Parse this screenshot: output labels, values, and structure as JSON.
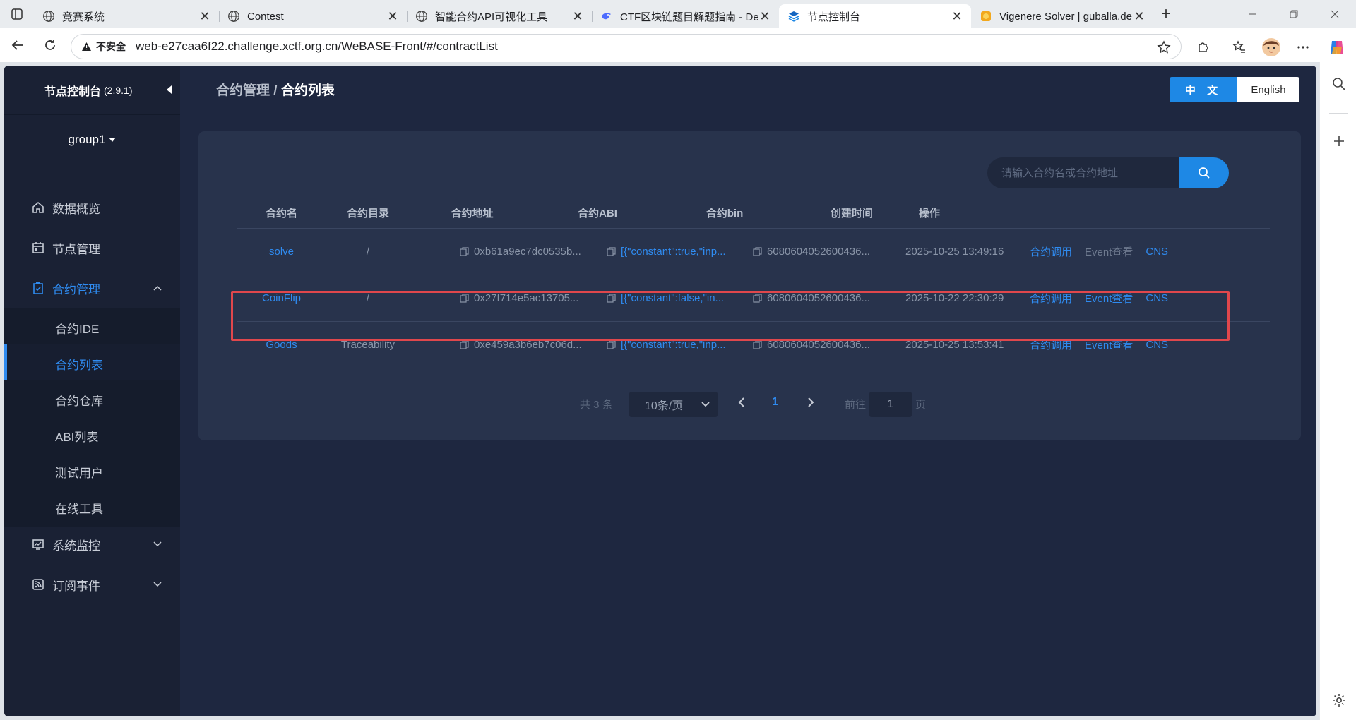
{
  "browser": {
    "tabs": [
      {
        "title": "竞赛系统",
        "icon": "globe-icon"
      },
      {
        "title": "Contest",
        "icon": "globe-icon"
      },
      {
        "title": "智能合约API可视化工具",
        "icon": "globe-icon"
      },
      {
        "title": "CTF区块链题目解题指南 - De",
        "icon": "deepseek-icon"
      },
      {
        "title": "节点控制台",
        "icon": "webase-layers-icon",
        "active": true
      },
      {
        "title": "Vigenere Solver | guballa.de",
        "icon": "guballa-icon"
      }
    ],
    "security_label": "不安全",
    "url": "web-e27caa6f22.challenge.xctf.org.cn/WeBASE-Front/#/contractList"
  },
  "sidebar": {
    "brand": "节点控制台",
    "version": "(2.9.1)",
    "group": "group1",
    "menu": [
      {
        "label": "数据概览",
        "icon": "home-icon"
      },
      {
        "label": "节点管理",
        "icon": "calendar-icon"
      },
      {
        "label": "合约管理",
        "icon": "clipboard-check-icon",
        "open": true
      },
      {
        "label": "系统监控",
        "icon": "chart-monitor-icon"
      },
      {
        "label": "订阅事件",
        "icon": "rss-icon"
      }
    ],
    "submenu": [
      "合约IDE",
      "合约列表",
      "合约仓库",
      "ABI列表",
      "测试用户",
      "在线工具"
    ]
  },
  "header": {
    "breadcrumb_parent": "合约管理",
    "breadcrumb_sep": " / ",
    "breadcrumb_current": "合约列表",
    "lang_zh": "中 文",
    "lang_en": "English"
  },
  "search": {
    "placeholder": "请输入合约名或合约地址"
  },
  "table": {
    "columns": [
      "合约名",
      "合约目录",
      "合约地址",
      "合约ABI",
      "合约bin",
      "创建时间",
      "操作"
    ],
    "rows": [
      {
        "name": "solve",
        "dir": "/",
        "address": "0xb61a9ec7dc0535b...",
        "abi": "[{\"constant\":true,\"inp...",
        "bin": "6080604052600436...",
        "time": "2025-10-25 13:49:16",
        "op_call": "合约调用",
        "op_event": "Event查看",
        "op_cns": "CNS"
      },
      {
        "name": "CoinFlip",
        "dir": "/",
        "address": "0x27f714e5ac13705...",
        "abi": "[{\"constant\":false,\"in...",
        "bin": "6080604052600436...",
        "time": "2025-10-22 22:30:29",
        "op_call": "合约调用",
        "op_event": "Event查看",
        "op_cns": "CNS"
      },
      {
        "name": "Goods",
        "dir": "Traceability",
        "address": "0xe459a3b6eb7c06d...",
        "abi": "[{\"constant\":true,\"inp...",
        "bin": "6080604052600436...",
        "time": "2025-10-25 13:53:41",
        "op_call": "合约调用",
        "op_event": "Event查看",
        "op_cns": "CNS"
      }
    ]
  },
  "pagination": {
    "total": "共 3 条",
    "page_size": "10条/页",
    "current": "1",
    "goto_label": "前往",
    "goto_value": "1",
    "page_suffix": "页"
  },
  "colors": {
    "accent": "#1e88e5",
    "link": "#2f8bf0",
    "highlight": "#e0474c",
    "sidebar_bg": "#1a2134",
    "content_bg": "#1e2740"
  }
}
